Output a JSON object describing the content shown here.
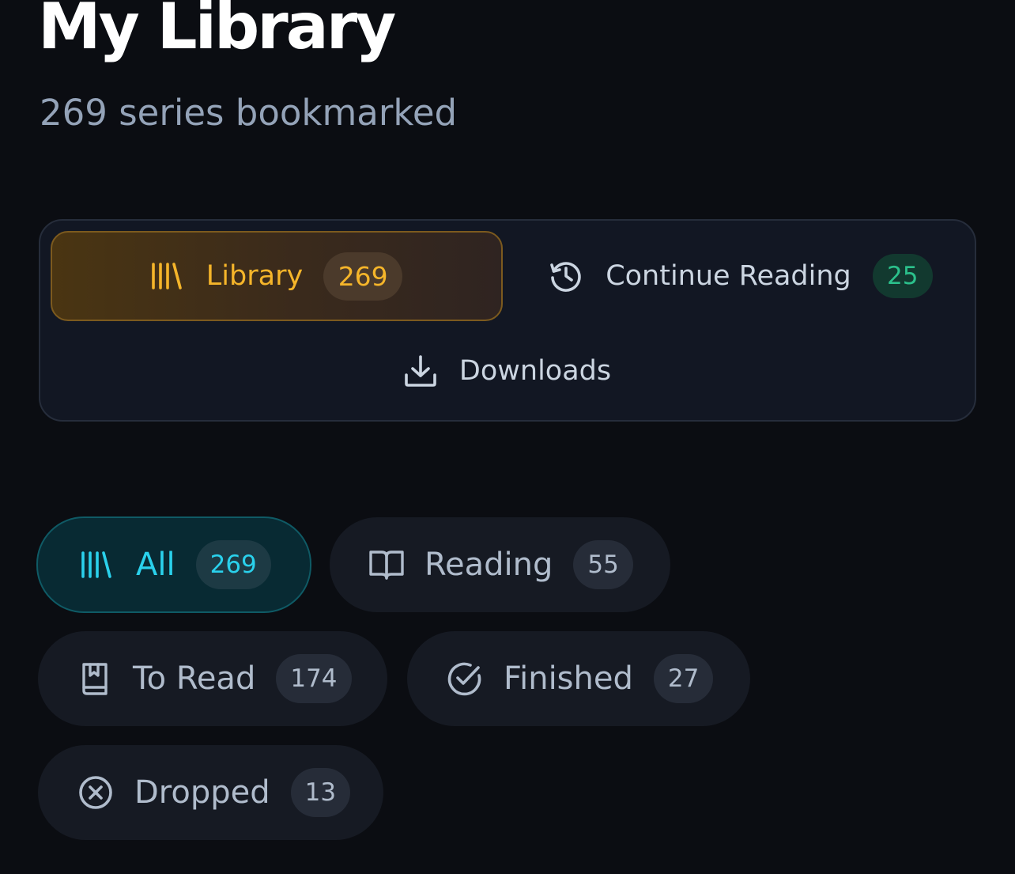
{
  "header": {
    "title": "My Library",
    "subtitle": "269 series bookmarked"
  },
  "tabs": [
    {
      "id": "library",
      "label": "Library",
      "count": "269",
      "icon": "library-icon",
      "active": true
    },
    {
      "id": "continue",
      "label": "Continue Reading",
      "count": "25",
      "icon": "history-icon",
      "active": false
    },
    {
      "id": "downloads",
      "label": "Downloads",
      "icon": "download-icon",
      "active": false
    }
  ],
  "filters": [
    {
      "id": "all",
      "label": "All",
      "count": "269",
      "icon": "library-icon",
      "active": true
    },
    {
      "id": "reading",
      "label": "Reading",
      "count": "55",
      "icon": "open-book-icon",
      "active": false
    },
    {
      "id": "to-read",
      "label": "To Read",
      "count": "174",
      "icon": "bookmark-book-icon",
      "active": false
    },
    {
      "id": "finished",
      "label": "Finished",
      "count": "27",
      "icon": "check-circle-icon",
      "active": false
    },
    {
      "id": "dropped",
      "label": "Dropped",
      "count": "13",
      "icon": "x-circle-icon",
      "active": false
    }
  ],
  "colors": {
    "background": "#0b0d12",
    "accent_amber": "#f5b52a",
    "accent_green": "#2bc08b",
    "accent_cyan": "#2ad1ec",
    "muted_text": "#94a3b8"
  }
}
